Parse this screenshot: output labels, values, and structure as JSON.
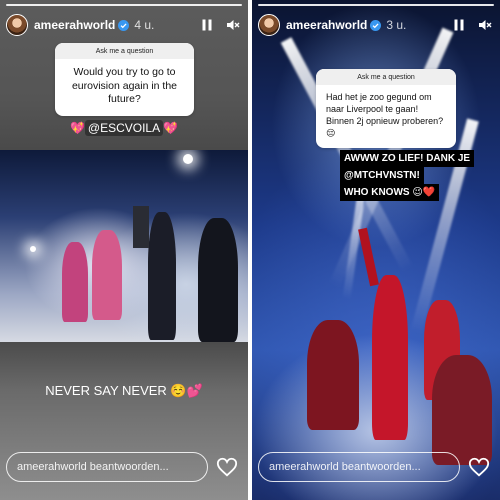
{
  "stories": [
    {
      "username": "ameerahworld",
      "time": "4 u.",
      "question_header": "Ask me a question",
      "question": "Would you try to go to eurovision again in the future?",
      "mention": "@ESCVOILA",
      "mention_emoji_left": "💖",
      "mention_emoji_right": "💖",
      "answer": "NEVER SAY NEVER ☺️💕",
      "reply_placeholder": "ameerahworld beantwoorden..."
    },
    {
      "username": "ameerahworld",
      "time": "3 u.",
      "question_header": "Ask me a question",
      "question": "Had het je zoo gegund om naar Liverpool te gaan! Binnen 2j opnieuw proberen? 😔",
      "answer_lines": [
        "AWWW ZO LIEF! DANK JE",
        "@MTCHVNSTN!",
        "WHO KNOWS 😉❤️"
      ],
      "reply_placeholder": "ameerahworld beantwoorden..."
    }
  ],
  "icons": {
    "pause": "pause-icon",
    "mute": "speaker-muted-icon",
    "verified": "verified-badge-icon",
    "heart": "heart-icon"
  },
  "colors": {
    "verified_blue": "#3897f0",
    "reply_border": "#ffffff",
    "question_header_bg": "#efefef"
  }
}
